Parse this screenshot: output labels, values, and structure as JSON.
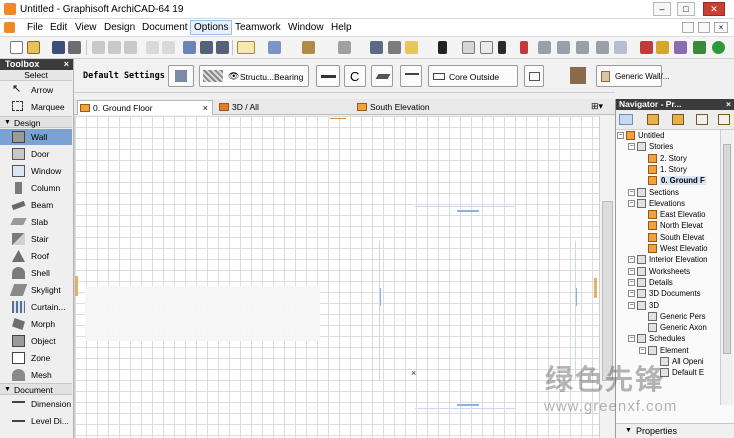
{
  "window": {
    "title": "Untitled - Graphisoft ArchiCAD-64 19",
    "controls": [
      "–",
      "□",
      "✕"
    ]
  },
  "menubar": {
    "items": [
      "File",
      "Edit",
      "View",
      "Design",
      "Document",
      "Options",
      "Teamwork",
      "Window",
      "Help"
    ],
    "active": "Options"
  },
  "toolbox": {
    "title": "Toolbox",
    "select_label": "Select",
    "tools_top": [
      {
        "label": "Arrow",
        "icon": "arrow-icon"
      },
      {
        "label": "Marquee",
        "icon": "marquee-icon"
      }
    ],
    "design_section": "Design",
    "design_tools": [
      {
        "label": "Wall",
        "icon": "wall-icon",
        "selected": true
      },
      {
        "label": "Door",
        "icon": "door-icon"
      },
      {
        "label": "Window",
        "icon": "window-icon"
      },
      {
        "label": "Column",
        "icon": "column-icon"
      },
      {
        "label": "Beam",
        "icon": "beam-icon"
      },
      {
        "label": "Slab",
        "icon": "slab-icon"
      },
      {
        "label": "Stair",
        "icon": "stair-icon"
      },
      {
        "label": "Roof",
        "icon": "roof-icon"
      },
      {
        "label": "Shell",
        "icon": "shell-icon"
      },
      {
        "label": "Skylight",
        "icon": "skylight-icon"
      },
      {
        "label": "Curtain...",
        "icon": "curtain-wall-icon"
      },
      {
        "label": "Morph",
        "icon": "morph-icon"
      },
      {
        "label": "Object",
        "icon": "object-icon"
      },
      {
        "label": "Zone",
        "icon": "zone-icon"
      },
      {
        "label": "Mesh",
        "icon": "mesh-icon"
      }
    ],
    "document_section": "Document",
    "document_tools": [
      {
        "label": "Dimension",
        "icon": "dimension-icon"
      },
      {
        "label": "Level Di...",
        "icon": "level-dimension-icon"
      }
    ]
  },
  "infobox": {
    "title": "Default Settings",
    "structure_label": "Structu...Bearing",
    "reference_line": "Core Outside",
    "composite": "Generic Wall/..."
  },
  "tabs": [
    {
      "label": "0. Ground Floor",
      "active": true,
      "close": "×"
    },
    {
      "label": "3D / All",
      "active": false
    },
    {
      "label": "South Elevation",
      "active": false
    }
  ],
  "navigator": {
    "title": "Navigator - Pr...",
    "tree": [
      {
        "label": "Untitled",
        "level": 0,
        "icon": "project-icon"
      },
      {
        "label": "Stories",
        "level": 1,
        "icon": "stories-icon"
      },
      {
        "label": "2. Story",
        "level": 2,
        "icon": "story-icon"
      },
      {
        "label": "1. Story",
        "level": 2,
        "icon": "story-icon"
      },
      {
        "label": "0. Ground F",
        "level": 2,
        "icon": "story-icon",
        "bold": true
      },
      {
        "label": "Sections",
        "level": 1,
        "icon": "section-icon"
      },
      {
        "label": "Elevations",
        "level": 1,
        "icon": "elevation-icon"
      },
      {
        "label": "East Elevatio",
        "level": 2,
        "icon": "elevation-view-icon"
      },
      {
        "label": "North Elevat",
        "level": 2,
        "icon": "elevation-view-icon"
      },
      {
        "label": "South Elevat",
        "level": 2,
        "icon": "elevation-view-icon"
      },
      {
        "label": "West Elevatio",
        "level": 2,
        "icon": "elevation-view-icon"
      },
      {
        "label": "Interior Elevation",
        "level": 1,
        "icon": "interior-elevation-icon"
      },
      {
        "label": "Worksheets",
        "level": 1,
        "icon": "worksheet-icon"
      },
      {
        "label": "Details",
        "level": 1,
        "icon": "details-icon"
      },
      {
        "label": "3D Documents",
        "level": 1,
        "icon": "3d-document-icon"
      },
      {
        "label": "3D",
        "level": 1,
        "icon": "3d-icon"
      },
      {
        "label": "Generic Pers",
        "level": 2,
        "icon": "perspective-icon"
      },
      {
        "label": "Generic Axon",
        "level": 2,
        "icon": "axonometry-icon"
      },
      {
        "label": "Schedules",
        "level": 1,
        "icon": "schedules-icon"
      },
      {
        "label": "Element",
        "level": 2,
        "icon": "element-icon"
      },
      {
        "label": "All Openi",
        "level": 3,
        "icon": "schedule-icon"
      },
      {
        "label": "Default E",
        "level": 3,
        "icon": "schedule-icon"
      }
    ],
    "properties_label": "Properties"
  },
  "watermark": {
    "text": "绿色先锋",
    "url": "www.greenxf.com"
  }
}
